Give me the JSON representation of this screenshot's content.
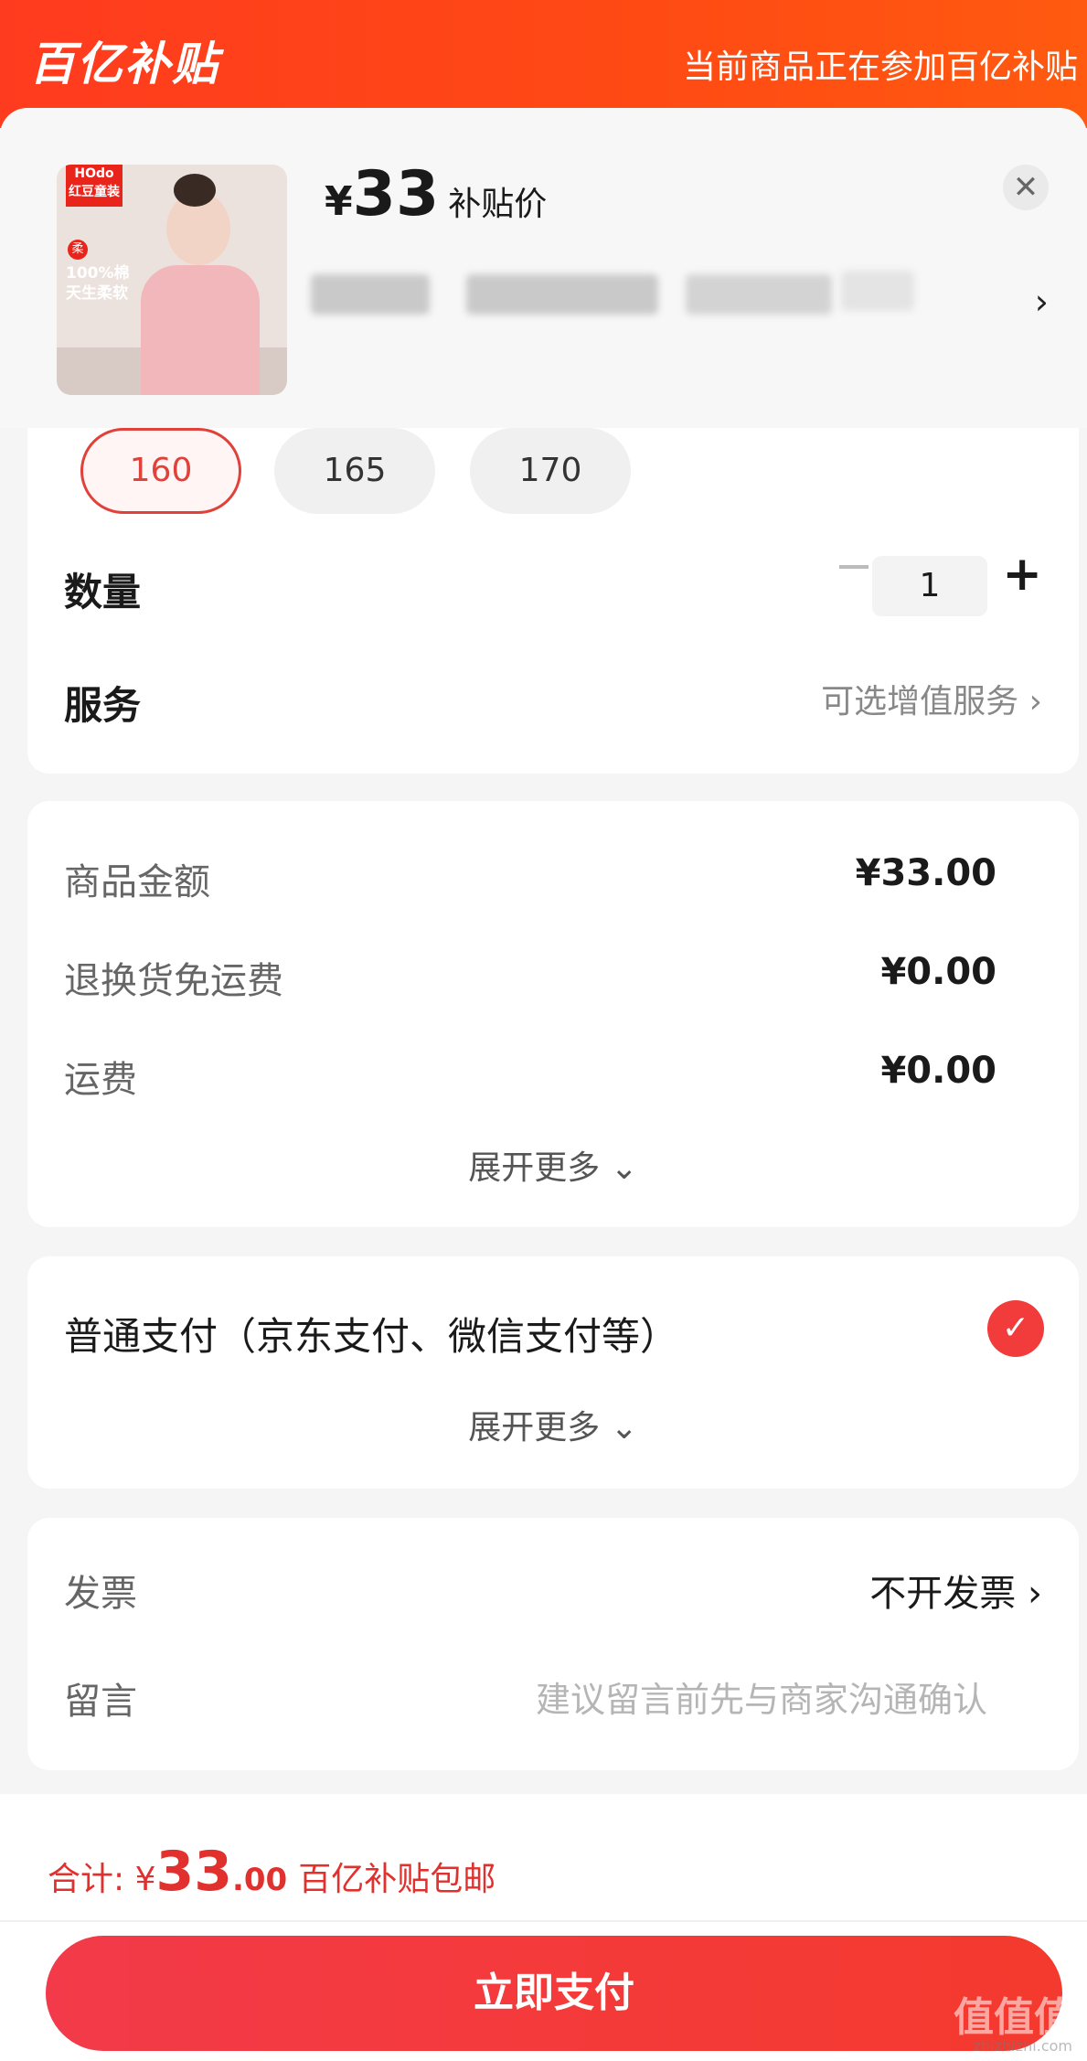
{
  "banner": {
    "logo": "百亿补贴",
    "message": "当前商品正在参加百亿补贴"
  },
  "product": {
    "thumb_brand": "HOdo\n红豆童装",
    "thumb_soft": "柔",
    "thumb_claim": "100%棉\n天生柔软",
    "currency": "¥",
    "price": "33",
    "price_label": "补贴价",
    "close_icon": "close-icon",
    "title_arrow": "›"
  },
  "sizes": [
    {
      "label": "160",
      "selected": true
    },
    {
      "label": "165",
      "selected": false
    },
    {
      "label": "170",
      "selected": false
    }
  ],
  "quantity": {
    "label": "数量",
    "value": "1",
    "minus": "−",
    "plus": "+"
  },
  "service": {
    "label": "服务",
    "hint": "可选增值服务 ›"
  },
  "amounts": {
    "rows": [
      {
        "label": "商品金额",
        "value": "¥33.00"
      },
      {
        "label": "退换货免运费",
        "value": "¥0.00"
      },
      {
        "label": "运费",
        "value": "¥0.00"
      }
    ],
    "expand": "展开更多 ⌄"
  },
  "payment": {
    "label": "普通支付（京东支付、微信支付等）",
    "check": "✓",
    "expand": "展开更多 ⌄"
  },
  "invoice": {
    "label": "发票",
    "value": "不开发票 ›"
  },
  "note": {
    "label": "留言",
    "placeholder": "建议留言前先与商家沟通确认"
  },
  "footer": {
    "total_label": "合计: ¥",
    "total_int": "33",
    "total_dec": ".00",
    "shipping": "百亿补贴包邮",
    "pay_button": "立即支付",
    "watermark": "值值值",
    "watermark_sub": "zhizhizhi.com"
  },
  "colors": {
    "accent": "#ff4a14",
    "red": "#e0312e",
    "button": "#f43a3a"
  }
}
